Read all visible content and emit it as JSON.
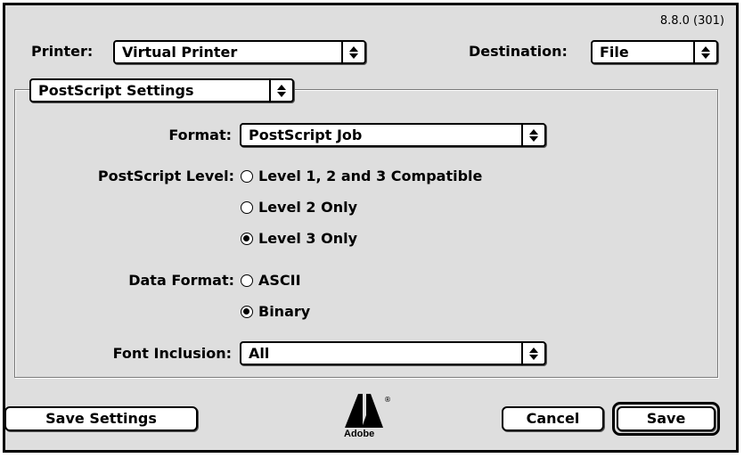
{
  "version": "8.8.0 (301)",
  "printer": {
    "label": "Printer:",
    "value": "Virtual Printer"
  },
  "destination": {
    "label": "Destination:",
    "value": "File"
  },
  "panel": {
    "value": "PostScript Settings"
  },
  "format": {
    "label": "Format:",
    "value": "PostScript Job"
  },
  "postscript_level": {
    "label": "PostScript Level:",
    "options": [
      {
        "label": "Level 1, 2 and 3 Compatible",
        "selected": false
      },
      {
        "label": "Level 2 Only",
        "selected": false
      },
      {
        "label": "Level 3 Only",
        "selected": true
      }
    ]
  },
  "data_format": {
    "label": "Data Format:",
    "options": [
      {
        "label": "ASCII",
        "selected": false
      },
      {
        "label": "Binary",
        "selected": true
      }
    ]
  },
  "font_inclusion": {
    "label": "Font Inclusion:",
    "value": "All"
  },
  "buttons": {
    "save_settings": "Save Settings",
    "cancel": "Cancel",
    "save": "Save"
  },
  "logo": {
    "text": "Adobe",
    "icon": "adobe-logo-icon"
  }
}
